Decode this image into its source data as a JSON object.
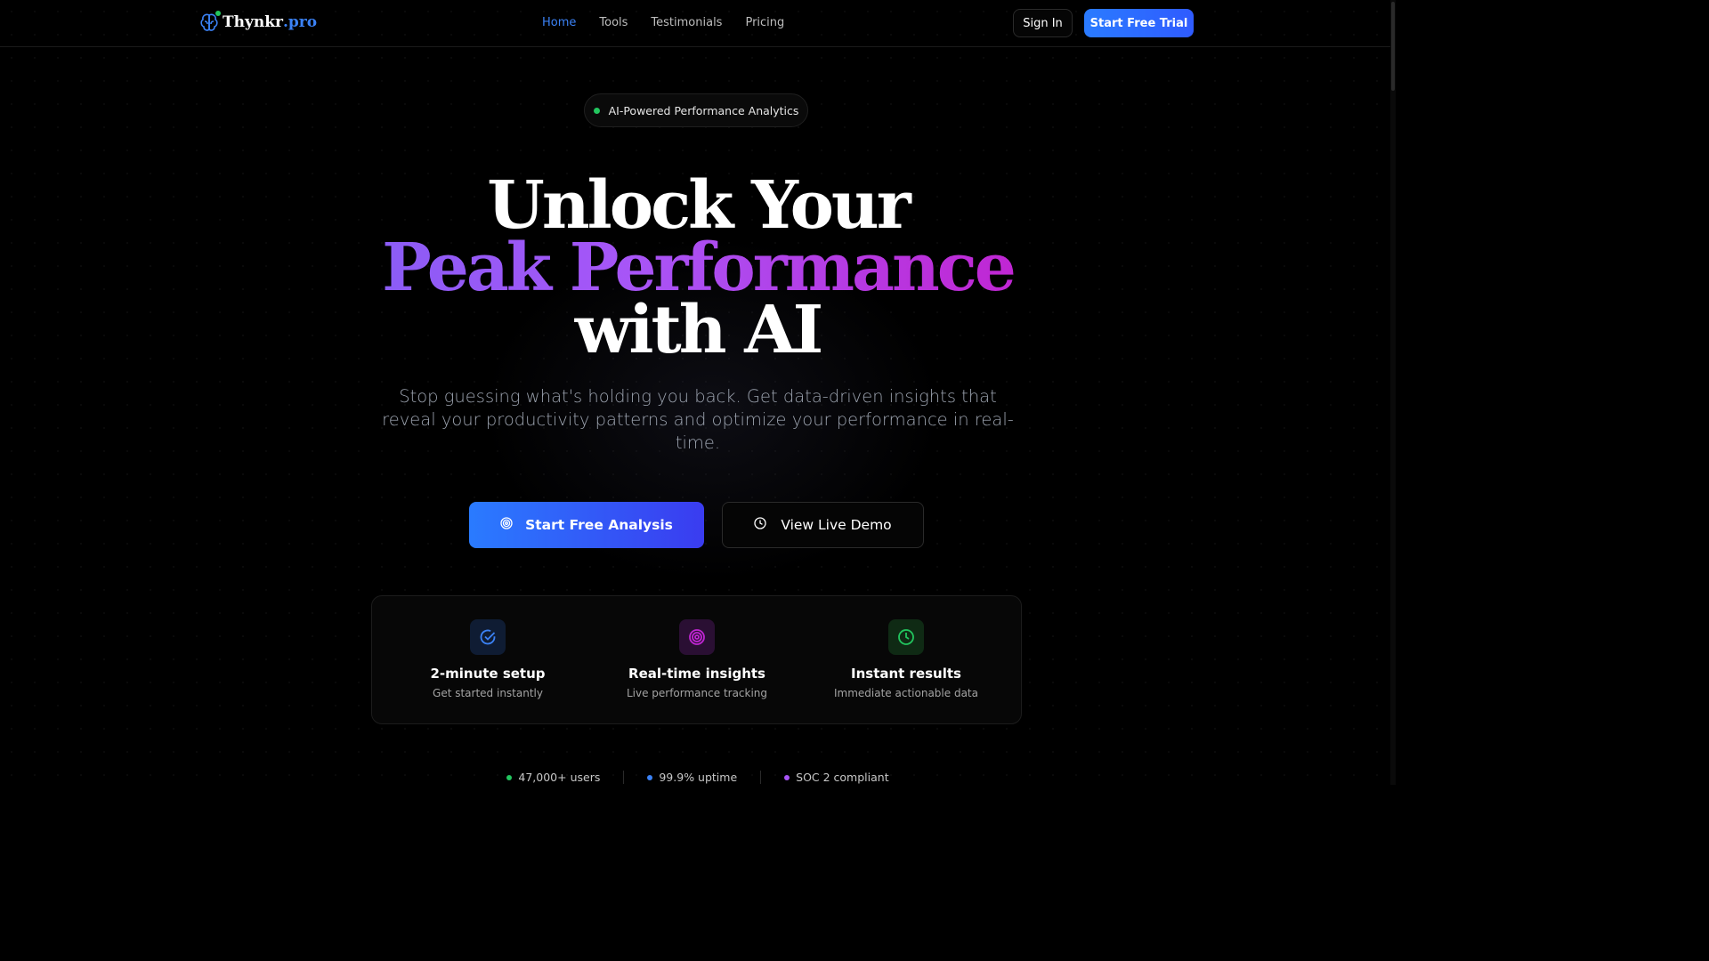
{
  "brand": {
    "name": "Thynkr",
    "suffix": ".pro",
    "icon": "brain-icon"
  },
  "nav": {
    "items": [
      {
        "label": "Home",
        "active": true
      },
      {
        "label": "Tools",
        "active": false
      },
      {
        "label": "Testimonials",
        "active": false
      },
      {
        "label": "Pricing",
        "active": false
      }
    ]
  },
  "header": {
    "signin_label": "Sign In",
    "trial_label": "Start Free Trial"
  },
  "badge": {
    "text": "AI-Powered Performance Analytics"
  },
  "hero": {
    "line1": "Unlock Your",
    "line2": "Peak Performance",
    "line3": "with AI",
    "subtitle": "Stop guessing what's holding you back. Get data-driven insights that reveal your productivity patterns and optimize your performance in real-time."
  },
  "cta": {
    "primary_label": "Start Free Analysis",
    "primary_icon": "target-icon",
    "secondary_label": "View Live Demo",
    "secondary_icon": "clock-icon"
  },
  "features": [
    {
      "title": "2-minute setup",
      "desc": "Get started instantly",
      "icon": "check-circle-icon",
      "color": "#3b82f6"
    },
    {
      "title": "Real-time insights",
      "desc": "Live performance tracking",
      "icon": "target-icon",
      "color": "#c026d3"
    },
    {
      "title": "Instant results",
      "desc": "Immediate actionable data",
      "icon": "clock-icon",
      "color": "#22c55e"
    }
  ],
  "stats": [
    {
      "text": "47,000+ users",
      "color": "#22c55e"
    },
    {
      "text": "99.9% uptime",
      "color": "#3b82f6"
    },
    {
      "text": "SOC 2 compliant",
      "color": "#a855f7"
    }
  ],
  "colors": {
    "accent": "#3b82f6",
    "purple": "#a855f7",
    "green": "#22c55e",
    "background": "#000000"
  }
}
